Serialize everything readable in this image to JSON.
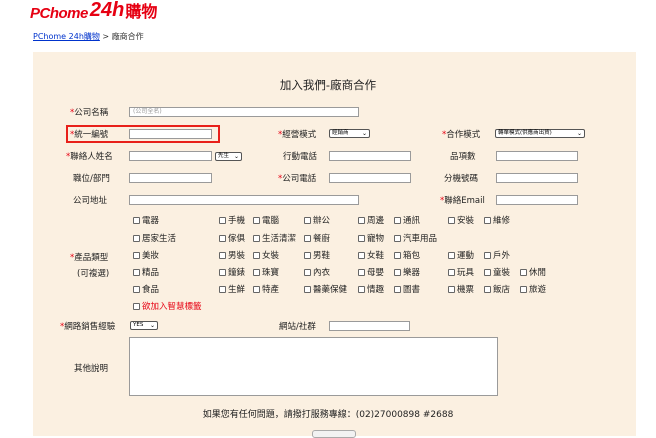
{
  "logo": {
    "p1": "PChome",
    "p2": "24h",
    "p3": "購物"
  },
  "breadcrumb": {
    "link": "PChome 24h購物",
    "sep": " > ",
    "current": "廠商合作"
  },
  "title": "加入我們-廠商合作",
  "form": {
    "company_name": {
      "label": "公司名稱",
      "placeholder": "(公司全名)"
    },
    "tax_id": {
      "label": "統一編號",
      "value": ""
    },
    "business_mode": {
      "label": "經營模式",
      "value": "經銷商"
    },
    "coop_mode": {
      "label": "合作模式",
      "value": "轉單模式(供應商出貨)"
    },
    "contact_name": {
      "label": "聯絡人姓名",
      "value": ""
    },
    "salutation": {
      "value": "先生"
    },
    "mobile": {
      "label": "行動電話",
      "value": ""
    },
    "item_count": {
      "label": "品項數",
      "value": ""
    },
    "position": {
      "label": "職位/部門",
      "value": ""
    },
    "company_phone": {
      "label": "公司電話",
      "value": ""
    },
    "extension": {
      "label": "分機號碼",
      "value": ""
    },
    "address": {
      "label": "公司地址",
      "value": ""
    },
    "email": {
      "label": "聯絡Email",
      "value": ""
    },
    "categories_label1": "產品類型",
    "categories_label2": "(可複選)",
    "categories": [
      [
        "電器",
        "手機",
        "電腦",
        "辦公",
        "周邊",
        "通訊",
        "安裝",
        "維修"
      ],
      [
        "居家生活",
        "傢俱",
        "生活清潔",
        "餐廚",
        "寵物",
        "汽車用品"
      ],
      [
        "美妝",
        "男裝",
        "女裝",
        "男鞋",
        "女鞋",
        "箱包",
        "運動",
        "戶外"
      ],
      [
        "精品",
        "鐘錶",
        "珠寶",
        "內衣",
        "母嬰",
        "樂器",
        "玩具",
        "童裝",
        "休閒"
      ],
      [
        "食品",
        "生鮮",
        "特產",
        "醫藥保健",
        "情趣",
        "圖書",
        "機票",
        "飯店",
        "旅遊"
      ]
    ],
    "smart_label": "欲加入智慧標籤",
    "online_exp": {
      "label": "網路銷售經驗",
      "value": "YES"
    },
    "website": {
      "label": "網站/社群",
      "value": ""
    },
    "notes": {
      "label": "其他說明",
      "value": ""
    }
  },
  "footer": "如果您有任何問題，請撥打服務專線：(02)27000898 #2688",
  "colors": {
    "panel": "#fbf0e1",
    "required": "#e60012",
    "highlight_box": "#e8201a",
    "link": "#0033cc"
  }
}
